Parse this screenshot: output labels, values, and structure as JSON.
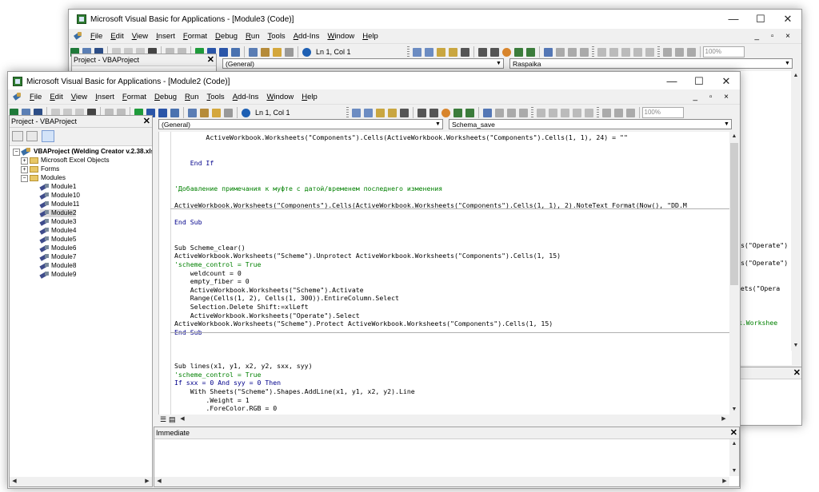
{
  "back_window": {
    "title": "Microsoft Visual Basic for Applications - [Module3 (Code)]",
    "menu": [
      "File",
      "Edit",
      "View",
      "Insert",
      "Format",
      "Debug",
      "Run",
      "Tools",
      "Add-Ins",
      "Window",
      "Help"
    ],
    "mdi_buttons": "_ ▫ ×",
    "status_position": "Ln 1, Col 1",
    "zoom": "100%",
    "project_title": "Project - VBAProject",
    "object_combo": "(General)",
    "procedure_combo": "Raspaika",
    "code_fragments": [
      "s(\"Operate\")",
      "s(\"Operate\")",
      "heets(\"Opera",
      "ok.Workshee"
    ]
  },
  "front_window": {
    "title": "Microsoft Visual Basic for Applications - [Module2 (Code)]",
    "menu": [
      "File",
      "Edit",
      "View",
      "Insert",
      "Format",
      "Debug",
      "Run",
      "Tools",
      "Add-Ins",
      "Window",
      "Help"
    ],
    "mdi_buttons": "_ ▫ ×",
    "status_position": "Ln 1, Col 1",
    "zoom": "100%",
    "project_title": "Project - VBAProject",
    "object_combo": "(General)",
    "procedure_combo": "Schema_save",
    "tree": {
      "root": "VBAProject (Welding Creator v.2.38.xls",
      "excel_objects": "Microsoft Excel Objects",
      "forms": "Forms",
      "modules": "Modules",
      "module_items": [
        "Module1",
        "Module10",
        "Module11",
        "Module2",
        "Module3",
        "Module4",
        "Module5",
        "Module6",
        "Module7",
        "Module8",
        "Module9"
      ],
      "selected": "Module2"
    },
    "code_lines": [
      {
        "t": "        ActiveWorkbook.Worksheets(\"Components\").Cells(ActiveWorkbook.Worksheets(\"Components\").Cells(1, 1), 24) = \"\"",
        "c": "n"
      },
      {
        "t": "",
        "c": "n"
      },
      {
        "t": "",
        "c": "n"
      },
      {
        "t": "    End If",
        "c": "k"
      },
      {
        "t": "",
        "c": "n"
      },
      {
        "t": "",
        "c": "n"
      },
      {
        "t": "'Добавление примечания к муфте с датой/временем последнего изменения",
        "c": "c"
      },
      {
        "t": "",
        "c": "n"
      },
      {
        "t": "ActiveWorkbook.Worksheets(\"Components\").Cells(ActiveWorkbook.Worksheets(\"Components\").Cells(1, 1), 2).NoteText Format(Now(), \"DD.M",
        "c": "n"
      },
      {
        "t": "",
        "c": "n"
      },
      {
        "t": "End Sub",
        "c": "k"
      },
      {
        "t": "",
        "c": "n"
      },
      {
        "t": "",
        "c": "n"
      },
      {
        "t": "Sub Scheme_clear()",
        "c": "n"
      },
      {
        "t": "ActiveWorkbook.Worksheets(\"Scheme\").Unprotect ActiveWorkbook.Worksheets(\"Components\").Cells(1, 15)",
        "c": "n"
      },
      {
        "t": "'scheme_control = True",
        "c": "c"
      },
      {
        "t": "    weldcount = 0",
        "c": "n"
      },
      {
        "t": "    empty_fiber = 0",
        "c": "n"
      },
      {
        "t": "    ActiveWorkbook.Worksheets(\"Scheme\").Activate",
        "c": "n"
      },
      {
        "t": "    Range(Cells(1, 2), Cells(1, 300)).EntireColumn.Select",
        "c": "n"
      },
      {
        "t": "    Selection.Delete Shift:=xlLeft",
        "c": "n"
      },
      {
        "t": "    ActiveWorkbook.Worksheets(\"Operate\").Select",
        "c": "n"
      },
      {
        "t": "ActiveWorkbook.Worksheets(\"Scheme\").Protect ActiveWorkbook.Worksheets(\"Components\").Cells(1, 15)",
        "c": "n"
      },
      {
        "t": "End Sub",
        "c": "k"
      },
      {
        "t": "",
        "c": "n"
      },
      {
        "t": "",
        "c": "n"
      },
      {
        "t": "",
        "c": "n"
      },
      {
        "t": "Sub lines(x1, y1, x2, y2, sxx, syy)",
        "c": "n"
      },
      {
        "t": "'scheme_control = True",
        "c": "c"
      },
      {
        "t": "If sxx = 0 And syy = 0 Then",
        "c": "k"
      },
      {
        "t": "    With Sheets(\"Scheme\").Shapes.AddLine(x1, y1, x2, y2).Line",
        "c": "n"
      },
      {
        "t": "        .Weight = 1",
        "c": "n"
      },
      {
        "t": "        .ForeColor.RGB = 0",
        "c": "n"
      }
    ],
    "immediate_title": "Immediate"
  }
}
